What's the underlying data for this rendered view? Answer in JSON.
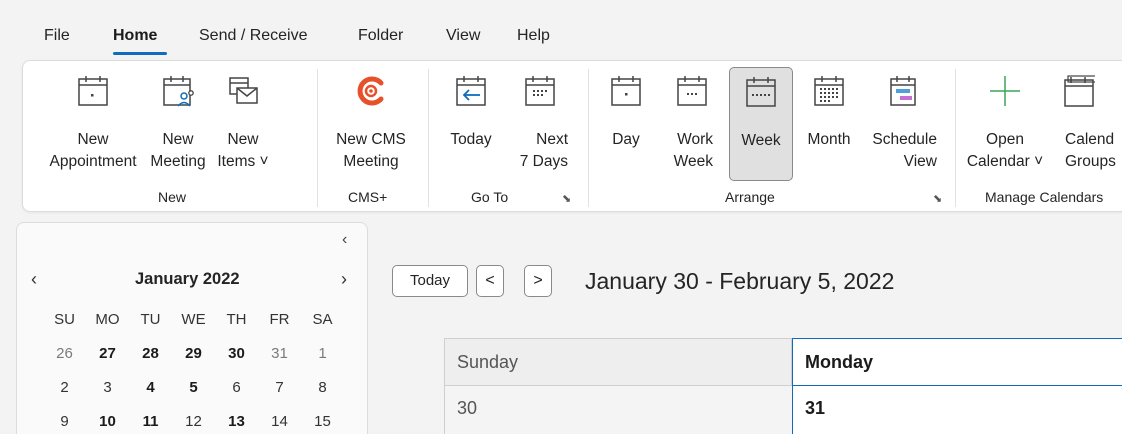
{
  "menu": {
    "items": [
      {
        "label": "File"
      },
      {
        "label": "Home"
      },
      {
        "label": "Send / Receive"
      },
      {
        "label": "Folder"
      },
      {
        "label": "View"
      },
      {
        "label": "Help"
      }
    ],
    "active": "Home"
  },
  "ribbon": {
    "new_appointment": "New\nAppointment",
    "new_meeting": "New\nMeeting",
    "new_items": "New\nItems ˅",
    "new_group": "New",
    "new_cms_meeting": "New CMS\nMeeting",
    "cms_group": "CMS+",
    "today": "Today",
    "next_7_days": "Next\n7 Days",
    "goto_group": "Go To",
    "day": "Day",
    "work_week": "Work\nWeek",
    "week": "Week",
    "month": "Month",
    "schedule_view": "Schedule\nView",
    "arrange_group": "Arrange",
    "open_calendar": "Open\nCalendar ˅",
    "calendar_groups": "Calend\nGroups",
    "manage_group": "Manage Calendars",
    "selected": "Week",
    "accent": "#0f6cbd",
    "cms_color": "#e8502a",
    "green": "#3aa657"
  },
  "mini_calendar": {
    "title": "January 2022",
    "collapse_glyph": "‹",
    "prev_glyph": "‹",
    "next_glyph": "›",
    "weekdays": [
      "SU",
      "MO",
      "TU",
      "WE",
      "TH",
      "FR",
      "SA"
    ],
    "weeks": [
      [
        {
          "d": "26",
          "s": "out"
        },
        {
          "d": "27",
          "s": "bold"
        },
        {
          "d": "28",
          "s": "bold"
        },
        {
          "d": "29",
          "s": "bold"
        },
        {
          "d": "30",
          "s": "bold"
        },
        {
          "d": "31",
          "s": "out"
        },
        {
          "d": "1",
          "s": "out"
        }
      ],
      [
        {
          "d": "2",
          "s": ""
        },
        {
          "d": "3",
          "s": ""
        },
        {
          "d": "4",
          "s": "bold"
        },
        {
          "d": "5",
          "s": "bold"
        },
        {
          "d": "6",
          "s": ""
        },
        {
          "d": "7",
          "s": ""
        },
        {
          "d": "8",
          "s": ""
        }
      ],
      [
        {
          "d": "9",
          "s": ""
        },
        {
          "d": "10",
          "s": "bold"
        },
        {
          "d": "11",
          "s": "bold"
        },
        {
          "d": "12",
          "s": ""
        },
        {
          "d": "13",
          "s": "bold"
        },
        {
          "d": "14",
          "s": ""
        },
        {
          "d": "15",
          "s": ""
        }
      ]
    ]
  },
  "main": {
    "today_button": "Today",
    "prev_glyph": "<",
    "next_glyph": ">",
    "range_title": "January 30 - February 5, 2022",
    "days": [
      {
        "name": "Sunday",
        "date": "30"
      },
      {
        "name": "Monday",
        "date": "31"
      }
    ]
  }
}
